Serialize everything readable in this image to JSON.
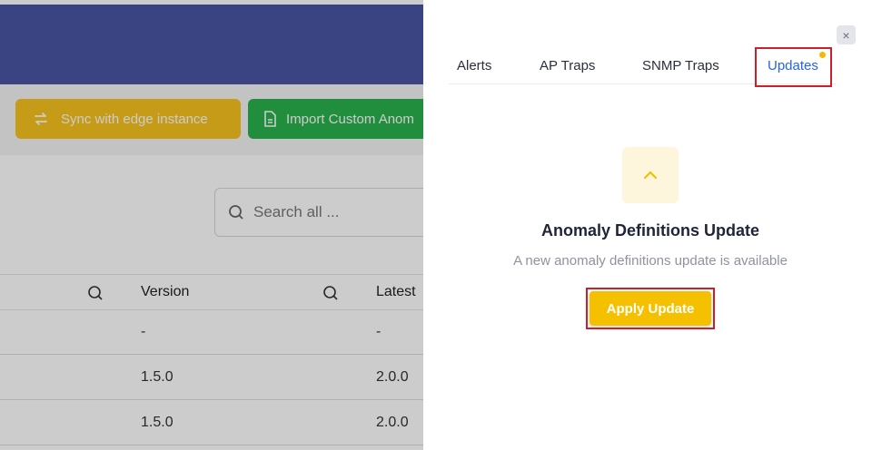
{
  "background": {
    "toolbar": {
      "sync_label": "Sync with edge instance",
      "import_label": "Import Custom Anom"
    },
    "search": {
      "placeholder": "Search all ..."
    },
    "table": {
      "headers": [
        "Version",
        "Latest"
      ],
      "rows": [
        [
          "-",
          "-"
        ],
        [
          "1.5.0",
          "2.0.0"
        ],
        [
          "1.5.0",
          "2.0.0"
        ]
      ]
    }
  },
  "panel": {
    "close_label": "×",
    "tabs": [
      {
        "label": "Alerts"
      },
      {
        "label": "AP Traps"
      },
      {
        "label": "SNMP Traps"
      },
      {
        "label": "Updates",
        "active": true
      }
    ],
    "update": {
      "icon": "arrow-up-icon",
      "title": "Anomaly Definitions Update",
      "subtitle": "A new anomaly definitions update is available",
      "apply_label": "Apply Update"
    }
  },
  "colors": {
    "header": "#4a55a3",
    "sync_button": "#f7c21e",
    "import_button": "#28b24b",
    "active_tab": "#2563eb",
    "apply_button": "#f5c000",
    "highlight": "#cc1f2a"
  }
}
